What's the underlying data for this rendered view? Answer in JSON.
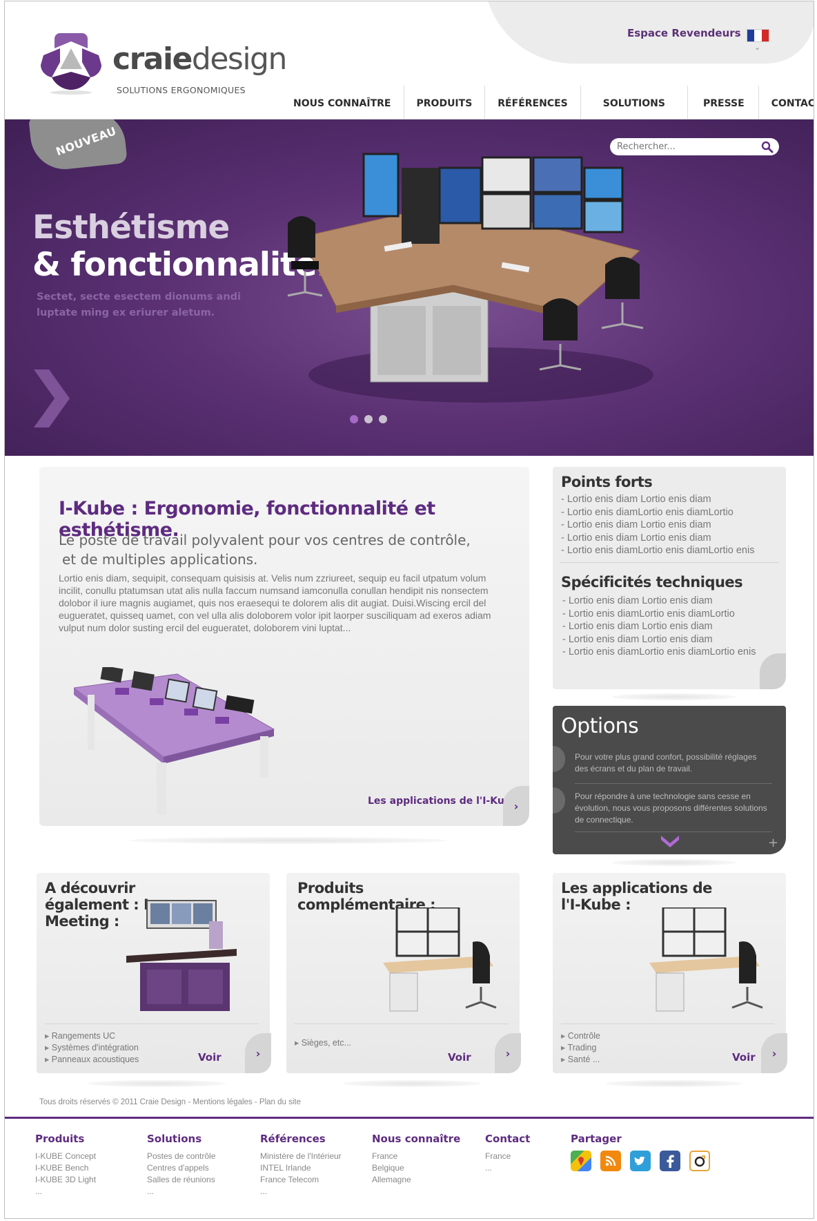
{
  "header": {
    "logo": {
      "name": "craiedesign",
      "name_part1": "craie",
      "name_part2": "design",
      "tagline": "SOLUTIONS ERGONOMIQUES"
    },
    "espace_revendeurs": "Espace Revendeurs",
    "language_flag": "fr-flag-icon",
    "nav": [
      "NOUS CONNAÎTRE",
      "PRODUITS",
      "RÉFÉRENCES",
      "SOLUTIONS",
      "PRESSE",
      "CONTACT"
    ]
  },
  "hero": {
    "badge": "NOUVEAU",
    "title_line1": "Esthétisme",
    "title_line2": "& fonctionnalité.",
    "subtitle": "Sectet, secte esectem dionums andi luptate ming ex eriurer aletum.",
    "search_placeholder": "Rechercher...",
    "slides_total": 3,
    "slide_active": 1
  },
  "main": {
    "title": "I-Kube : Ergonomie, fonctionnalité et esthétisme.",
    "lead_line1": "Le poste de travail polyvalent pour vos centres de contrôle,",
    "lead_line2": "et de multiples applications.",
    "body": "Lortio enis diam, sequipit, consequam quisisis at. Velis num zzriureet, sequip eu facil utpatum volum incilit, conullu ptatumsan utat alis nulla faccum numsand iamconulla conullan hendipit nis nonsectem dolobor il iure magnis augiamet, quis nos eraesequi te dolorem alis dit augiat. Duisi.Wiscing ercil del eugueratet, quisseq uamet, con vel ulla alis doloborem volor ipit laorper susciliquam ad exeros adiam vulput num dolor susting   ercil del eugueratet, doloborem vini luptat...",
    "link": "Les applications de l'I-Kube",
    "link_arrow": "›"
  },
  "points_forts": {
    "title": "Points forts",
    "items": [
      "- Lortio enis diam Lortio enis diam",
      "- Lortio enis diamLortio enis diamLortio",
      "- Lortio enis diam Lortio enis diam",
      "- Lortio enis diam Lortio enis diam",
      "- Lortio enis diamLortio enis diamLortio enis"
    ]
  },
  "specificites": {
    "title": "Spécificités techniques",
    "items": [
      "- Lortio enis diam Lortio enis diam",
      "- Lortio enis diamLortio enis diamLortio",
      "- Lortio enis diam Lortio enis diam",
      "- Lortio enis diam Lortio enis diam",
      "- Lortio enis diamLortio enis diamLortio enis"
    ]
  },
  "options": {
    "title": "Options",
    "item1": "Pour votre plus grand confort, possibilité réglages des écrans et du plan  de travail.",
    "item2": "Pour répondre à une technologie sans cesse en évolution, nous vous proposons  différentes solutions de connectique.",
    "plus": "+"
  },
  "cards": [
    {
      "title": "A découvrir également : I-Meeting :",
      "items": [
        "Rangements UC",
        "Systèmes d'intégration",
        "Panneaux acoustiques"
      ],
      "voir": "Voir",
      "arrow": "›"
    },
    {
      "title": "Produits complémentaire :",
      "items": [
        "Sièges, etc..."
      ],
      "voir": "Voir",
      "arrow": "›"
    },
    {
      "title": "Les applications de l'I-Kube :",
      "items": [
        "Contrôle",
        "Trading",
        "Santé ..."
      ],
      "voir": "Voir",
      "arrow": "›"
    }
  ],
  "copyright": "Tous droits réservés © 2011 Craie Design - Mentions légales - Plan du site",
  "footer": {
    "produits": {
      "title": "Produits",
      "items": [
        "I-KUBE Concept",
        "I-KUBE Bench",
        "I-KUBE 3D Light",
        "..."
      ]
    },
    "solutions": {
      "title": "Solutions",
      "items": [
        "Postes de contrôle",
        "Centres d'appels",
        "Salles de réunions",
        "..."
      ]
    },
    "references": {
      "title": "Références",
      "items": [
        "Ministère de l'Intérieur",
        "INTEL Irlande",
        "France Telecom",
        "..."
      ]
    },
    "nous_connaitre": {
      "title": "Nous connaître",
      "items": [
        "France",
        "Belgique",
        "Allemagne"
      ]
    },
    "contact": {
      "title": "Contact",
      "items": [
        "France",
        "..."
      ]
    },
    "partager": {
      "title": "Partager",
      "icons": [
        "google-maps-icon",
        "rss-icon",
        "twitter-icon",
        "facebook-icon",
        "netvibes-icon"
      ]
    }
  },
  "colors": {
    "brand_purple": "#5e2b80",
    "hero_bg": "#5b3174",
    "options_bg": "#4b4b4b"
  }
}
